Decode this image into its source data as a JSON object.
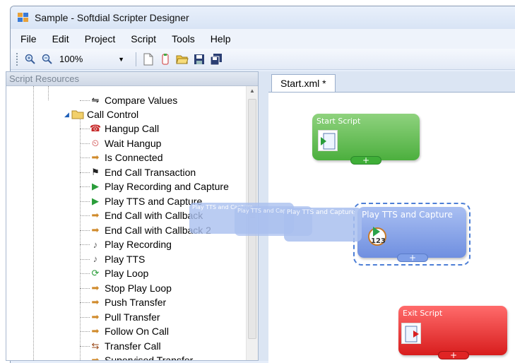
{
  "window": {
    "title": "Sample - Softdial Scripter Designer"
  },
  "menu": [
    "File",
    "Edit",
    "Project",
    "Script",
    "Tools",
    "Help"
  ],
  "toolbar": {
    "zoom_value": "100%",
    "icons": [
      "zoom-in-icon",
      "zoom-out-icon",
      "new-document-icon",
      "new-script-icon",
      "open-folder-icon",
      "save-icon",
      "save-all-icon"
    ]
  },
  "resources": {
    "header": "Script Resources",
    "items": [
      {
        "label": "Compare Values",
        "icon": "compare-icon"
      },
      {
        "label": "Call Control",
        "icon": "folder-icon"
      },
      {
        "label": "Hangup Call",
        "icon": "hangup-icon"
      },
      {
        "label": "Wait Hangup",
        "icon": "wait-hangup-icon"
      },
      {
        "label": "Is Connected",
        "icon": "action-icon"
      },
      {
        "label": "End Call Transaction",
        "icon": "checkered-flag-icon"
      },
      {
        "label": "Play Recording and Capture",
        "icon": "play-capture-icon"
      },
      {
        "label": "Play TTS and Capture",
        "icon": "play-capture-icon"
      },
      {
        "label": "End Call with Callback",
        "icon": "action-icon"
      },
      {
        "label": "End Call with Callback 2",
        "icon": "action-icon"
      },
      {
        "label": "Play Recording",
        "icon": "speaker-icon"
      },
      {
        "label": "Play TTS",
        "icon": "speaker-icon"
      },
      {
        "label": "Play Loop",
        "icon": "loop-icon"
      },
      {
        "label": "Stop Play Loop",
        "icon": "action-icon"
      },
      {
        "label": "Push Transfer",
        "icon": "action-icon"
      },
      {
        "label": "Pull Transfer",
        "icon": "action-icon"
      },
      {
        "label": "Follow On Call",
        "icon": "action-icon"
      },
      {
        "label": "Transfer Call",
        "icon": "transfer-icon"
      },
      {
        "label": "Supervised Transfer",
        "icon": "action-icon"
      }
    ]
  },
  "document_tab": "Start.xml *",
  "nodes": {
    "start": {
      "title": "Start Script",
      "plus": "+",
      "color": "#4caf3e"
    },
    "play_tts": {
      "title": "Play TTS and Capture",
      "plus": "+",
      "color": "#6f8fe0"
    },
    "exit": {
      "title": "Exit Script",
      "plus": "+",
      "color": "#e02424"
    }
  },
  "drag_ghosts": [
    "Play TTS and Capture",
    "Play TTS and Capture",
    "Play TTS and Capture"
  ]
}
